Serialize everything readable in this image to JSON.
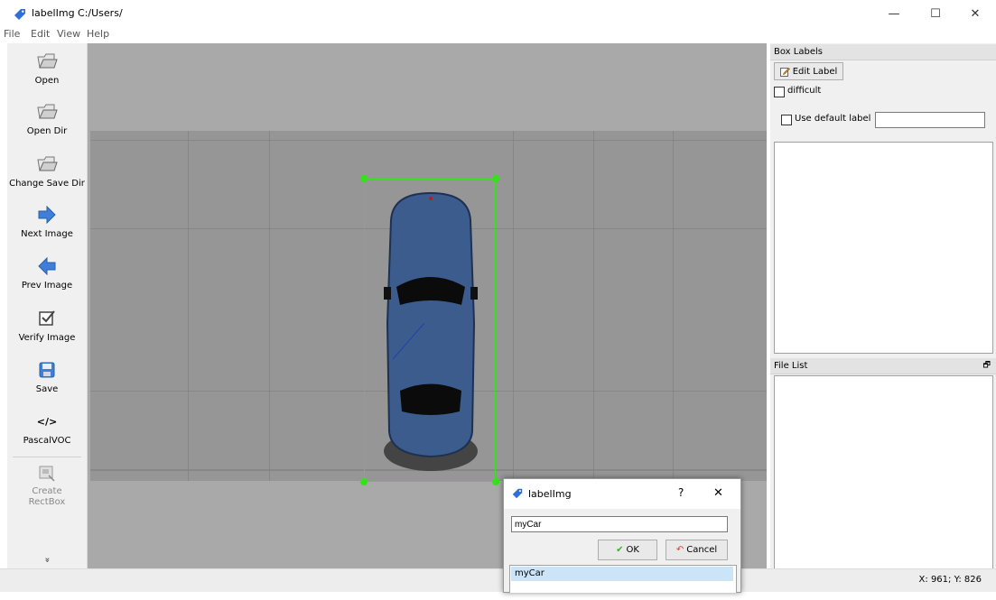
{
  "window": {
    "title": "labelImg C:/Users/",
    "minimize_symbol": "—",
    "maximize_symbol": "☐",
    "close_symbol": "✕"
  },
  "menu": [
    "File",
    "Edit",
    "View",
    "Help"
  ],
  "toolbar": {
    "items": [
      {
        "label": "Open",
        "icon": "folder-icon"
      },
      {
        "label": "Open Dir",
        "icon": "folder-icon"
      },
      {
        "label": "Change Save Dir",
        "icon": "folder-icon"
      },
      {
        "label": "Next Image",
        "icon": "arrow-right-icon"
      },
      {
        "label": "Prev Image",
        "icon": "arrow-left-icon"
      },
      {
        "label": "Verify Image",
        "icon": "checkbox-icon"
      },
      {
        "label": "Save",
        "icon": "save-icon"
      },
      {
        "label": "PascalVOC",
        "icon": "code-icon",
        "glyph": "</>"
      },
      {
        "label": "Create\nRectBox",
        "icon": "rectbox-icon",
        "disabled": true
      }
    ],
    "more_glyph": "»"
  },
  "box_labels": {
    "title": "Box Labels",
    "edit_label": "Edit Label",
    "difficult": "difficult",
    "use_default_label": "Use default label",
    "default_label_value": ""
  },
  "file_list": {
    "title": "File List",
    "float_icon": "🗗"
  },
  "status": {
    "coords": "X: 961; Y: 826"
  },
  "dialog": {
    "title": "labelImg",
    "help_symbol": "?",
    "close_symbol": "✕",
    "input_value": "myCar",
    "ok_label": "OK",
    "cancel_label": "Cancel",
    "list_items": [
      "myCar"
    ]
  },
  "colors": {
    "bbox": "#39e21a",
    "car_body": "#3c5c8d",
    "canvas_bg": "#a9a9a9",
    "selected_item": "#cce4f7"
  }
}
